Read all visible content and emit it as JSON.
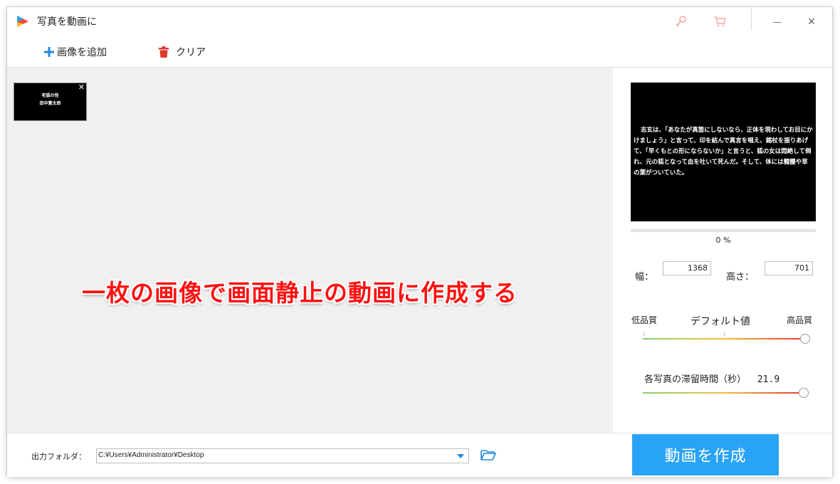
{
  "window": {
    "title": "写真を動画に",
    "icons": {
      "app": "app-logo-icon",
      "key": "key-icon",
      "cart": "cart-icon",
      "minimize": "minimize-icon",
      "close": "close-icon"
    },
    "minimize_glyph": "—",
    "close_glyph": "✕"
  },
  "toolbar": {
    "add_image_label": "画像を追加",
    "clear_label": "クリア"
  },
  "image_area": {
    "thumbnail": {
      "line1": "老狐の怪",
      "line2": "田中實太郎",
      "close_glyph": "✕"
    },
    "overlay_caption": "一枚の画像で画面静止の動画に作成する"
  },
  "preview": {
    "text": "志玄は、「あなたが真箇にしないなら、正体を現わしてお目にかけましょう」と言って、印を結んで真言を唱え、錫杖を振りあげて、「早くもとの形にならないか」と言うと、狐の女は悶絶して倒れ、元の狐となって血を吐いて死んだ。そして、体には髑髏や草の葉がついていた。",
    "progress_text": "0 %",
    "progress_value": 0
  },
  "dimensions": {
    "width_label": "幅：",
    "width_value": "1368",
    "height_label": "高さ：",
    "height_value": "701"
  },
  "quality": {
    "low_label": "低品質",
    "default_label": "デフォルト値",
    "high_label": "高品質",
    "value_fraction": 1.0
  },
  "duration": {
    "label": "各写真の滞留時間（秒）",
    "value": "21.9",
    "value_fraction": 1.0
  },
  "output": {
    "label": "出力フォルダ：",
    "path": "C:¥Users¥Administrator¥Desktop"
  },
  "create_button_label": "動画を作成",
  "colors": {
    "accent": "#29a3f5",
    "caption": "#ff1010",
    "clear_icon": "#e03a2c",
    "add_icon": "#1e88e5"
  }
}
